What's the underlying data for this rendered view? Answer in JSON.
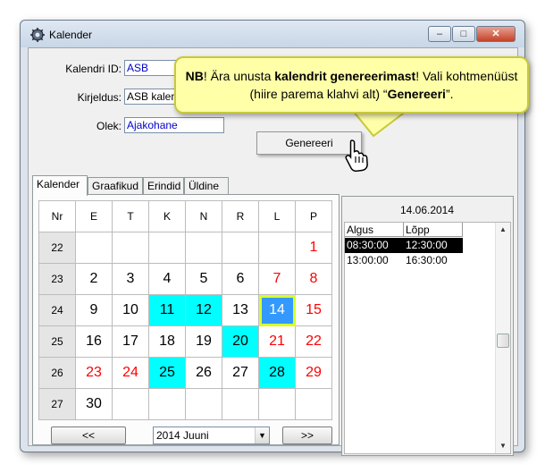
{
  "window": {
    "title": "Kalender"
  },
  "controls": {
    "minimize": "–",
    "maximize": "□",
    "close": "✕"
  },
  "form": {
    "id_label": "Kalendri ID:",
    "id_value": "ASB",
    "desc_label": "Kirjeldus:",
    "desc_value": "ASB kalend",
    "status_label": "Olek:",
    "status_value": "Ajakohane"
  },
  "tabs": [
    "Kalender",
    "Graafikud",
    "Erindid",
    "Üldine"
  ],
  "calendar": {
    "headers": [
      "Nr",
      "E",
      "T",
      "K",
      "N",
      "R",
      "L",
      "P"
    ],
    "rows": [
      {
        "nr": "22",
        "days": [
          "",
          "",
          "",
          "",
          "",
          "",
          "1"
        ]
      },
      {
        "nr": "23",
        "days": [
          "2",
          "3",
          "4",
          "5",
          "6",
          "7",
          "8"
        ]
      },
      {
        "nr": "24",
        "days": [
          "9",
          "10",
          "11",
          "12",
          "13",
          "14",
          "15"
        ]
      },
      {
        "nr": "25",
        "days": [
          "16",
          "17",
          "18",
          "19",
          "20",
          "21",
          "22"
        ]
      },
      {
        "nr": "26",
        "days": [
          "23",
          "24",
          "25",
          "26",
          "27",
          "28",
          "29"
        ]
      },
      {
        "nr": "27",
        "days": [
          "30",
          "",
          "",
          "",
          "",
          "",
          ""
        ]
      }
    ],
    "highlighted_days": [
      "11",
      "12",
      "20",
      "25",
      "28"
    ],
    "red_days": [
      "1",
      "7",
      "8",
      "15",
      "21",
      "22",
      "23",
      "24",
      "29"
    ],
    "selected_day": "14"
  },
  "nav": {
    "prev": "<<",
    "next": ">>",
    "month": "2014 Juuni"
  },
  "day_panel": {
    "date": "14.06.2014",
    "columns": [
      "Algus",
      "Lõpp"
    ],
    "rows": [
      {
        "start": "08:30:00",
        "end": "12:30:00",
        "selected": true
      },
      {
        "start": "13:00:00",
        "end": "16:30:00",
        "selected": false
      }
    ]
  },
  "context_menu": {
    "item": "Genereeri"
  },
  "callout": {
    "nb": "NB",
    "part1": "! Ära unusta ",
    "bold1": "kalendrit genereerimast",
    "part2": "! Vali kohtmenüüst (hiire parema klahvi alt) “",
    "bold2": "Genereeri",
    "part3": "”."
  },
  "colors": {
    "highlight": "#00ffff",
    "selected": "#3399ff",
    "weekend": "#ff0000",
    "callout_bg": "#ffffa8"
  }
}
